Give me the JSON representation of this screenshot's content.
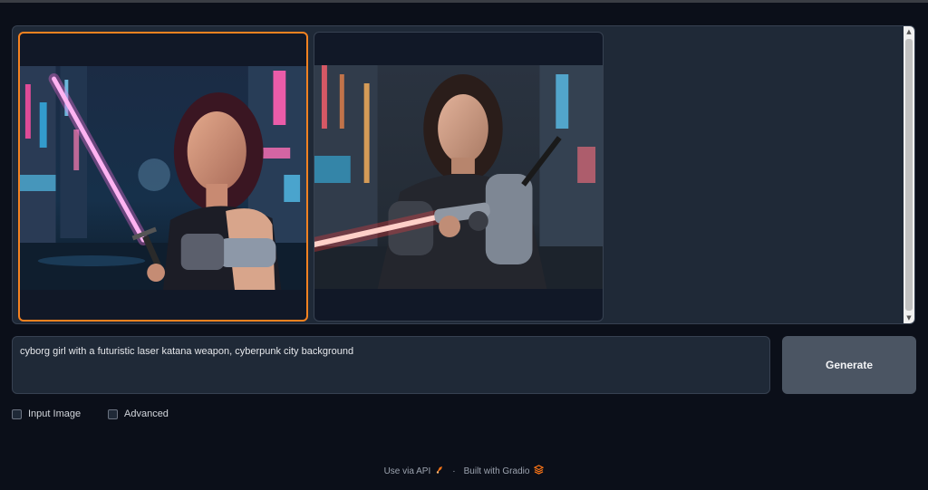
{
  "gallery": {
    "images": [
      {
        "alt": "cyborg girl with pink laser katana, neon city"
      },
      {
        "alt": "cyborg girl with red laser katana, neon city"
      }
    ],
    "selected_index": 0
  },
  "prompt": {
    "value": "cyborg girl with a futuristic laser katana weapon, cyberpunk city background"
  },
  "generate_label": "Generate",
  "options": {
    "input_image_label": "Input Image",
    "advanced_label": "Advanced"
  },
  "footer": {
    "api_label": "Use via API",
    "separator": "·",
    "built_label": "Built with Gradio"
  },
  "colors": {
    "background": "#0b0f19",
    "panel": "#1f2937",
    "accent": "#f58220",
    "button": "#4b5563"
  }
}
